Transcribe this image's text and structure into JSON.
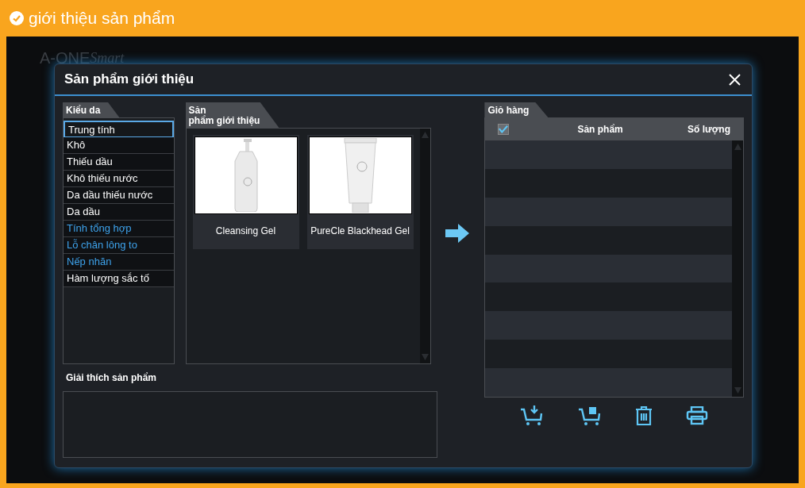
{
  "banner": {
    "title": "giới thiệu sản phẩm"
  },
  "background_app": {
    "logo": "A-ONE",
    "logo_script": "Smart"
  },
  "dialog": {
    "title": "Sản phẩm giới thiệu"
  },
  "skin_types": {
    "title": "Kiểu da",
    "items": [
      {
        "label": "Trung tính",
        "selected": true,
        "highlighted": false
      },
      {
        "label": "Khô",
        "selected": false,
        "highlighted": false
      },
      {
        "label": "Thiếu dầu",
        "selected": false,
        "highlighted": false
      },
      {
        "label": "Khô thiếu nước",
        "selected": false,
        "highlighted": false
      },
      {
        "label": "Da dầu thiếu nước",
        "selected": false,
        "highlighted": false
      },
      {
        "label": "Da dầu",
        "selected": false,
        "highlighted": false
      },
      {
        "label": "Tính tổng hợp",
        "selected": false,
        "highlighted": true
      },
      {
        "label": "Lỗ chân lông to",
        "selected": false,
        "highlighted": true
      },
      {
        "label": "Nếp nhăn",
        "selected": false,
        "highlighted": true
      },
      {
        "label": "Hàm lượng sắc tố",
        "selected": false,
        "highlighted": false
      }
    ]
  },
  "products": {
    "title_line1": "Sản",
    "title_line2": "phẩm giới thiệu",
    "items": [
      {
        "name": "Cleansing Gel",
        "kind": "bottle"
      },
      {
        "name": "PureCle Blackhead Gel",
        "kind": "tube"
      }
    ]
  },
  "explanation": {
    "title": "Giải thích sản phẩm"
  },
  "cart": {
    "title": "Giỏ hàng",
    "select_all": {
      "checked": true
    },
    "columns": [
      "Sản phẩm",
      "Số lượng"
    ]
  }
}
